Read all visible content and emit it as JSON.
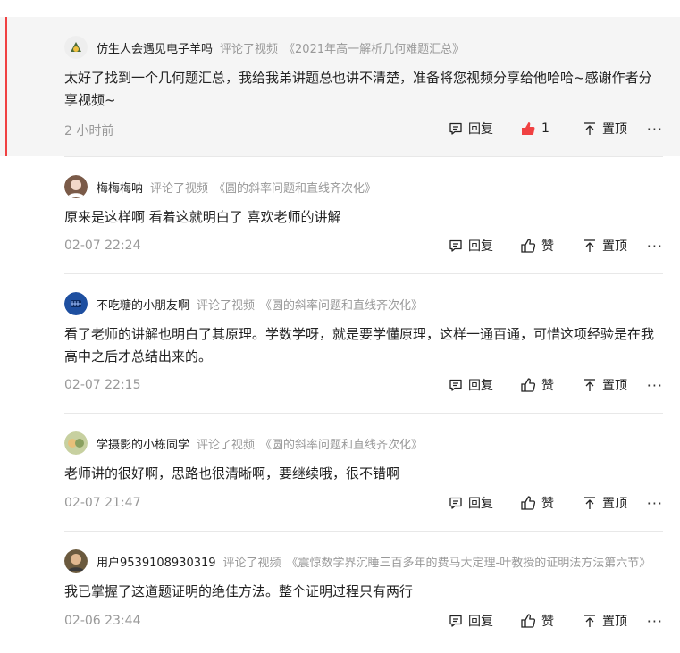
{
  "comments": [
    {
      "username": "仿生人会遇见电子羊吗",
      "verb": "评论了视频",
      "video_title": "《2021年高一解析几何难题汇总》",
      "text": "太好了找到一个几何题汇总，我给我弟讲题总也讲不清楚，准备将您视频分享给他哈哈~感谢作者分享视频~",
      "time": "2 小时前",
      "reply_label": "回复",
      "like_label": "1",
      "pin_label": "置顶",
      "more_label": "···",
      "liked": true,
      "avatar_color": "#d9d9d9"
    },
    {
      "username": "梅梅梅呐",
      "verb": "评论了视频",
      "video_title": "《圆的斜率问题和直线齐次化》",
      "text": "原来是这样啊 看着这就明白了 喜欢老师的讲解",
      "time": "02-07 22:24",
      "reply_label": "回复",
      "like_label": "赞",
      "pin_label": "置顶",
      "more_label": "···",
      "liked": false,
      "avatar_color": "#8d6e63"
    },
    {
      "username": "不吃糖的小朋友啊",
      "verb": "评论了视频",
      "video_title": "《圆的斜率问题和直线齐次化》",
      "text": "看了老师的讲解也明白了其原理。学数学呀，就是要学懂原理，这样一通百通，可惜这项经验是在我高中之后才总结出来的。",
      "time": "02-07 22:15",
      "reply_label": "回复",
      "like_label": "赞",
      "pin_label": "置顶",
      "more_label": "···",
      "liked": false,
      "avatar_color": "#1e4fa0"
    },
    {
      "username": "学摄影的小栋同学",
      "verb": "评论了视频",
      "video_title": "《圆的斜率问题和直线齐次化》",
      "text": "老师讲的很好啊，思路也很清晰啊，要继续哦，很不错啊",
      "time": "02-07 21:47",
      "reply_label": "回复",
      "like_label": "赞",
      "pin_label": "置顶",
      "more_label": "···",
      "liked": false,
      "avatar_color": "#9aa86a"
    },
    {
      "username": "用户9539108930319",
      "verb": "评论了视频",
      "video_title": "《震惊数学界沉睡三百多年的费马大定理-叶教授的证明法方法第六节》",
      "text": "我已掌握了这道题证明的绝佳方法。整个证明过程只有两行",
      "time": "02-06 23:44",
      "reply_label": "回复",
      "like_label": "赞",
      "pin_label": "置顶",
      "more_label": "···",
      "liked": false,
      "avatar_color": "#6b5a3e"
    }
  ],
  "colors": {
    "accent": "#f04142",
    "muted": "#999999",
    "text": "#222222"
  }
}
